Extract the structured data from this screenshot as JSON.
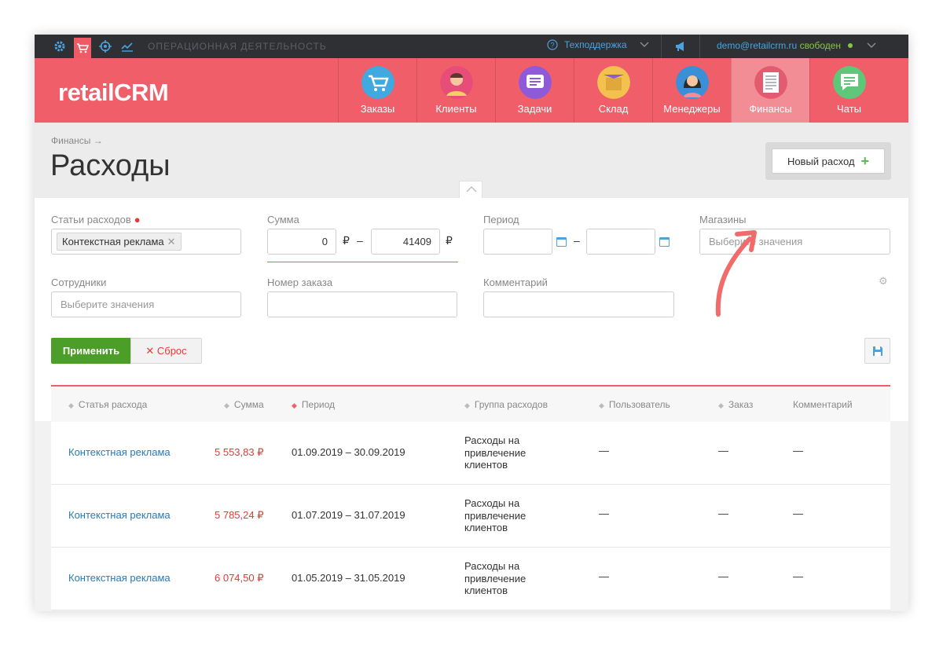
{
  "topbar": {
    "title": "ОПЕРАЦИОННАЯ ДЕЯТЕЛЬНОСТЬ",
    "support": "Техподдержка",
    "email": "demo@retailcrm.ru",
    "status": "свободен",
    "icons": [
      "gear-icon",
      "cart-icon",
      "target-icon",
      "chart-icon",
      "question-icon",
      "megaphone-icon"
    ]
  },
  "logo": "retailCRM",
  "nav": [
    {
      "label": "Заказы",
      "color": "#3fa9e0"
    },
    {
      "label": "Клиенты",
      "color": "#e84d7a"
    },
    {
      "label": "Задачи",
      "color": "#8e5ad8"
    },
    {
      "label": "Склад",
      "color": "#f2c14e"
    },
    {
      "label": "Менеджеры",
      "color": "#3a8fd6"
    },
    {
      "label": "Финансы",
      "color": "#e35b6e"
    },
    {
      "label": "Чаты",
      "color": "#5fc77a"
    }
  ],
  "breadcrumb": "Финансы →",
  "page_title": "Расходы",
  "new_button": "Новый расход",
  "filters": {
    "expense_items_label": "Статьи расходов",
    "expense_items_tag": "Контекстная реклама",
    "sum_label": "Сумма",
    "sum_from": "0",
    "sum_to": "41409",
    "currency": "₽",
    "period_label": "Период",
    "shops_label": "Магазины",
    "shops_placeholder": "Выберите значения",
    "employees_label": "Сотрудники",
    "employees_placeholder": "Выберите значения",
    "order_label": "Номер заказа",
    "comment_label": "Комментарий",
    "apply": "Применить",
    "reset": "Сброс"
  },
  "table": {
    "headers": [
      "Статья расхода",
      "Сумма",
      "Период",
      "Группа расходов",
      "Пользователь",
      "Заказ",
      "Комментарий"
    ],
    "rows": [
      {
        "name": "Контекстная реклама",
        "sum": "5 553,83 ₽",
        "period": "01.09.2019 – 30.09.2019",
        "group": "Расходы на привлечение клиентов",
        "user": "—",
        "order": "—",
        "comment": "—"
      },
      {
        "name": "Контекстная реклама",
        "sum": "5 785,24 ₽",
        "period": "01.07.2019 – 31.07.2019",
        "group": "Расходы на привлечение клиентов",
        "user": "—",
        "order": "—",
        "comment": "—"
      },
      {
        "name": "Контекстная реклама",
        "sum": "6 074,50 ₽",
        "period": "01.05.2019 – 31.05.2019",
        "group": "Расходы на привлечение клиентов",
        "user": "—",
        "order": "—",
        "comment": "—"
      }
    ]
  },
  "colors": {
    "brand": "#ef5e69",
    "link": "#2a79b6",
    "apply": "#4b9e28"
  }
}
